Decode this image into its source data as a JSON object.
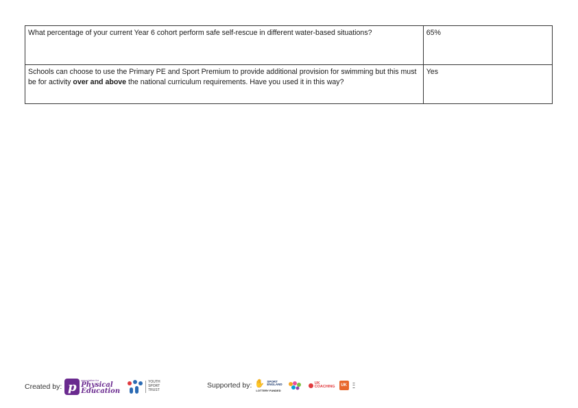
{
  "table": {
    "rows": [
      {
        "question": "What percentage of your current Year 6 cohort perform safe self-rescue in different water-based situations?",
        "answer": "65%"
      },
      {
        "question_pre": "Schools can choose to use the Primary PE and Sport Premium to provide additional provision for swimming but this must be for activity ",
        "question_bold": "over and above",
        "question_post": " the national curriculum requirements. Have you used it in this way?",
        "answer": "Yes"
      }
    ]
  },
  "footer": {
    "created_label": "Created by:",
    "afpe_small": "association for",
    "afpe_line1": "Physical",
    "afpe_line2": "Education",
    "yst_line1": "YOUTH",
    "yst_line2": "SPORT",
    "yst_line3": "TRUST",
    "supported_label": "Supported by:",
    "se_line1": "SPORT",
    "se_line2": "ENGLAND",
    "lottery": "LOTTERY FUNDED",
    "ukc_line1": "UK",
    "ukc_line2": "COACHING",
    "ukc_box": "UK"
  }
}
